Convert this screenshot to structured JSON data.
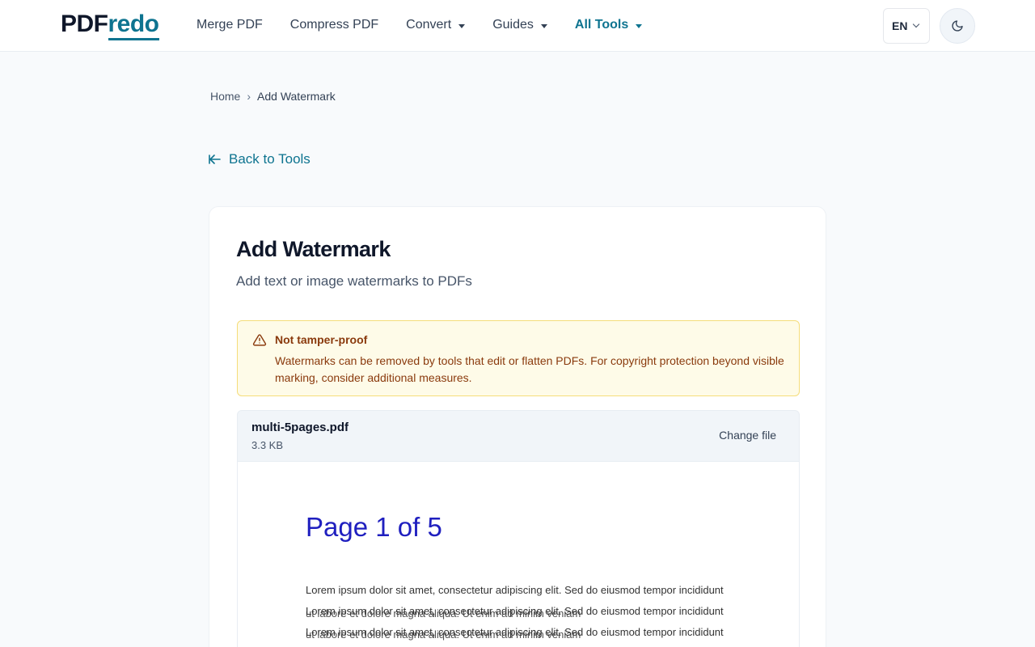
{
  "header": {
    "logo_part1": "PDF",
    "logo_part2": "redo",
    "nav": {
      "merge": "Merge PDF",
      "compress": "Compress PDF",
      "convert": "Convert",
      "guides": "Guides",
      "all_tools": "All Tools"
    },
    "lang": "EN",
    "theme_icon": "moon-icon"
  },
  "breadcrumb": {
    "home": "Home",
    "separator": "›",
    "current": "Add Watermark"
  },
  "back_link": "Back to Tools",
  "tool": {
    "title": "Add Watermark",
    "subtitle": "Add text or image watermarks to PDFs"
  },
  "alert": {
    "title": "Not tamper-proof",
    "body": "Watermarks can be removed by tools that edit or flatten PDFs. For copyright protection beyond visible marking, consider additional measures."
  },
  "file": {
    "name": "multi-5pages.pdf",
    "size": "3.3 KB",
    "change_label": "Change file"
  },
  "preview": {
    "page_title": "Page 1 of 5",
    "line1": "Lorem ipsum dolor sit amet, consectetur adipiscing elit. Sed do eiusmod tempor incididunt",
    "line2": "Lorem ipsum dolor sit amet, consectetur adipiscing elit. Sed do eiusmod tempor incididunt",
    "line2_overlap": "ut labore et dolore magna aliqua. Ut enim ad minim veniam",
    "line3": "Lorem ipsum dolor sit amet, consectetur adipiscing elit. Sed do eiusmod tempor incididunt",
    "line3_overlap": "ut labore et dolore magna aliqua. Ut enim ad minim veniam"
  },
  "colors": {
    "accent": "#0e7490",
    "warning_bg": "#fefbe8",
    "warning_text": "#8a3a0d",
    "preview_title": "#1f1fbf"
  }
}
